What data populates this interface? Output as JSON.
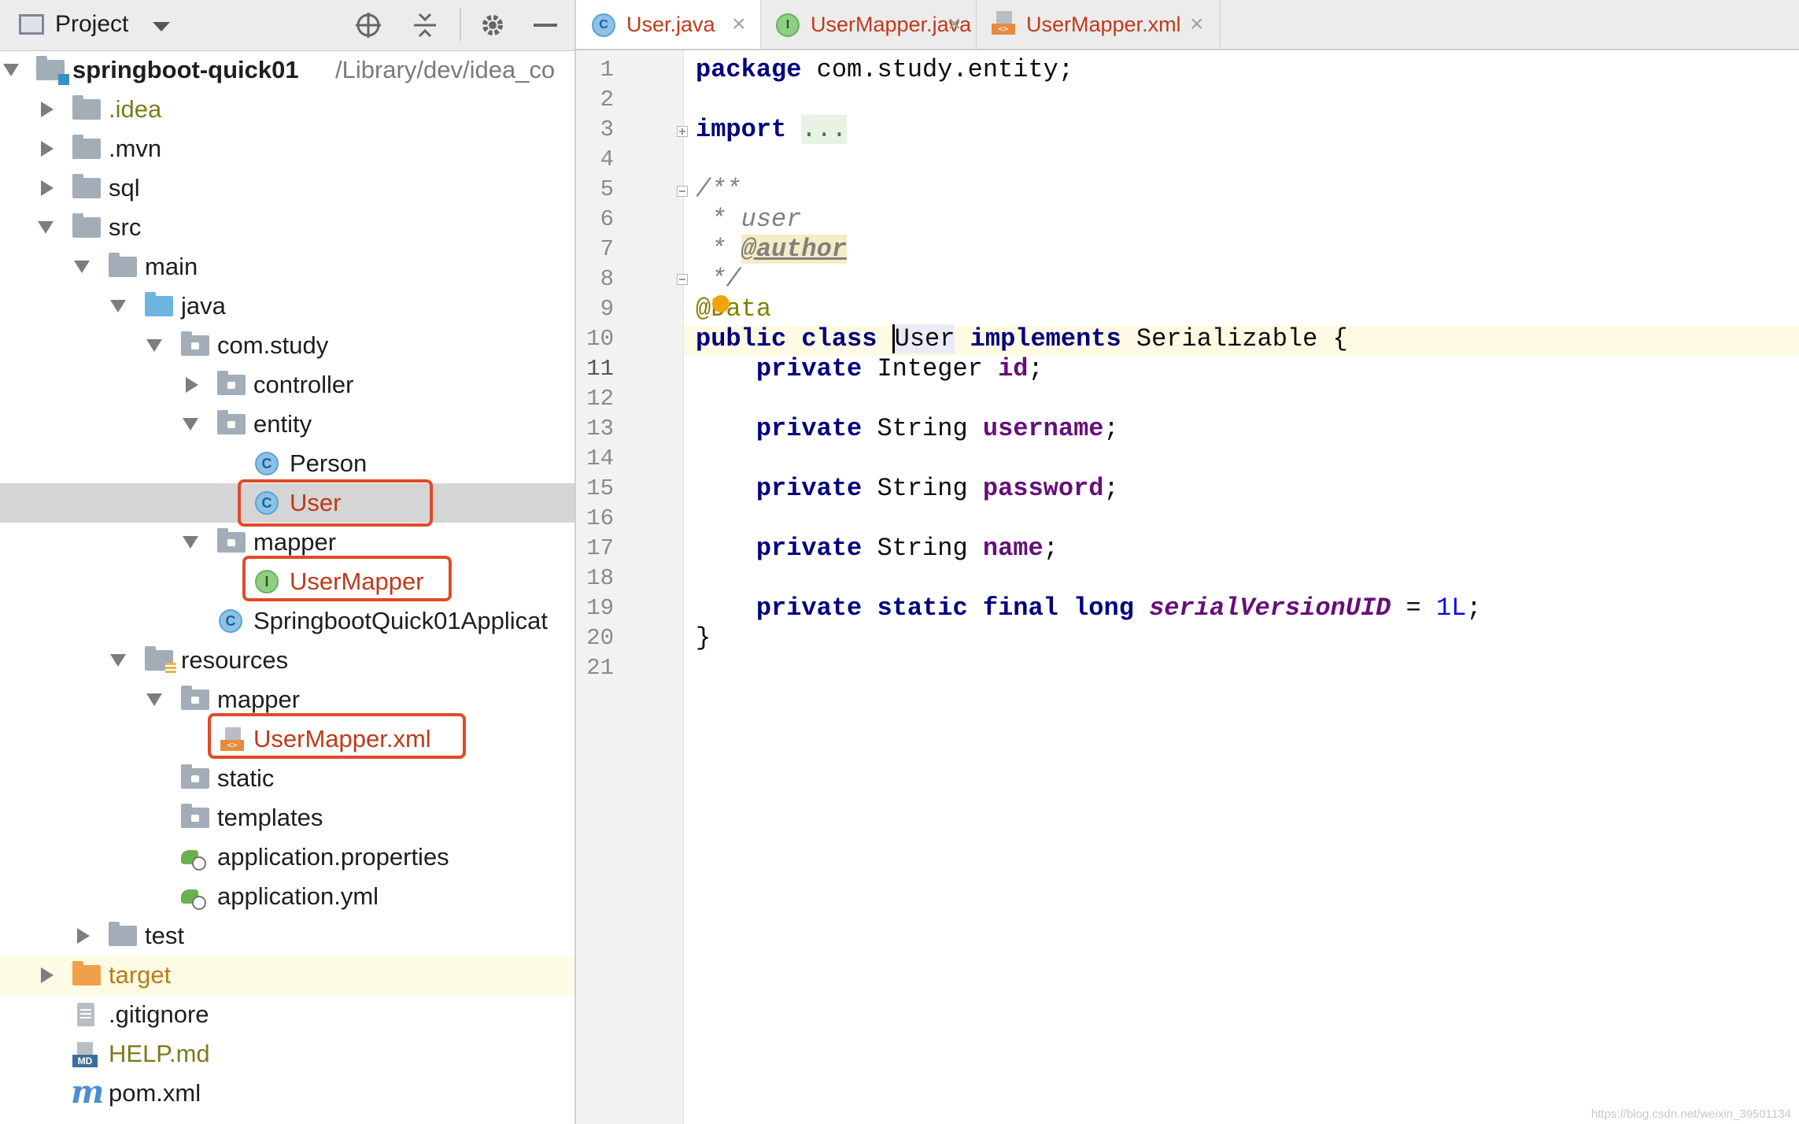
{
  "project_panel": {
    "title": "Project",
    "root": {
      "name": "springboot-quick01",
      "path": "/Library/dev/idea_co"
    },
    "tree": [
      {
        "label": ".idea"
      },
      {
        "label": ".mvn"
      },
      {
        "label": "sql"
      },
      {
        "label": "src"
      },
      {
        "label": "main"
      },
      {
        "label": "java"
      },
      {
        "label": "com.study"
      },
      {
        "label": "controller"
      },
      {
        "label": "entity"
      },
      {
        "label": "Person"
      },
      {
        "label": "User"
      },
      {
        "label": "mapper"
      },
      {
        "label": "UserMapper"
      },
      {
        "label": "SpringbootQuick01Applicat"
      },
      {
        "label": "resources"
      },
      {
        "label": "mapper"
      },
      {
        "label": "UserMapper.xml"
      },
      {
        "label": "static"
      },
      {
        "label": "templates"
      },
      {
        "label": "application.properties"
      },
      {
        "label": "application.yml"
      },
      {
        "label": "test"
      },
      {
        "label": "target"
      },
      {
        "label": ".gitignore"
      },
      {
        "label": "HELP.md"
      },
      {
        "label": "pom.xml"
      }
    ],
    "icon_letters": {
      "class": "C",
      "interface": "I",
      "md": "MD",
      "maven": "m",
      "xml": "<>"
    }
  },
  "tabs": [
    {
      "label": "User.java",
      "active": true
    },
    {
      "label": "UserMapper.java",
      "active": false
    },
    {
      "label": "UserMapper.xml",
      "active": false
    }
  ],
  "close_glyph": "×",
  "editor": {
    "line_numbers": [
      "1",
      "2",
      "3",
      "4",
      "5",
      "6",
      "7",
      "8",
      "9",
      "10",
      "11",
      "12",
      "13",
      "14",
      "15",
      "16",
      "17",
      "18",
      "19",
      "20",
      "21"
    ],
    "current_line": 11,
    "tokens": {
      "l1_kw": "package",
      "l1_rest": " com.study.entity;",
      "l3_kw": "import",
      "l3_sp": " ",
      "l3_dots": "...",
      "l6": "/**",
      "l7": " * user",
      "l8_pre": " * ",
      "l8_tag": "@author",
      "l9": " */",
      "l10": "@Data",
      "l11_kw": "public class",
      "l11_sp": " ",
      "l11_name": "User",
      "l11_sp2": " ",
      "l11_impl": "implements",
      "l11_rest": " Serializable {",
      "indent": "    ",
      "private": "private",
      "l12_type": " Integer ",
      "l12_fld": "id",
      "semi": ";",
      "l14_type": " String ",
      "l14_fld": "username",
      "l16_type": " String ",
      "l16_fld": "password",
      "l18_type": " String ",
      "l18_fld": "name",
      "l20_kw": "private static final long",
      "l20_sp": " ",
      "l20_fld": "serialVersionUID",
      "l20_eq": " = ",
      "l20_num": "1L",
      "l21": "}"
    }
  },
  "watermark": "https://blog.csdn.net/weixin_39501134",
  "colors": {
    "highlight_box": "#e14a28",
    "keyword": "#000080",
    "field": "#660e7a",
    "number": "#0000ff"
  }
}
